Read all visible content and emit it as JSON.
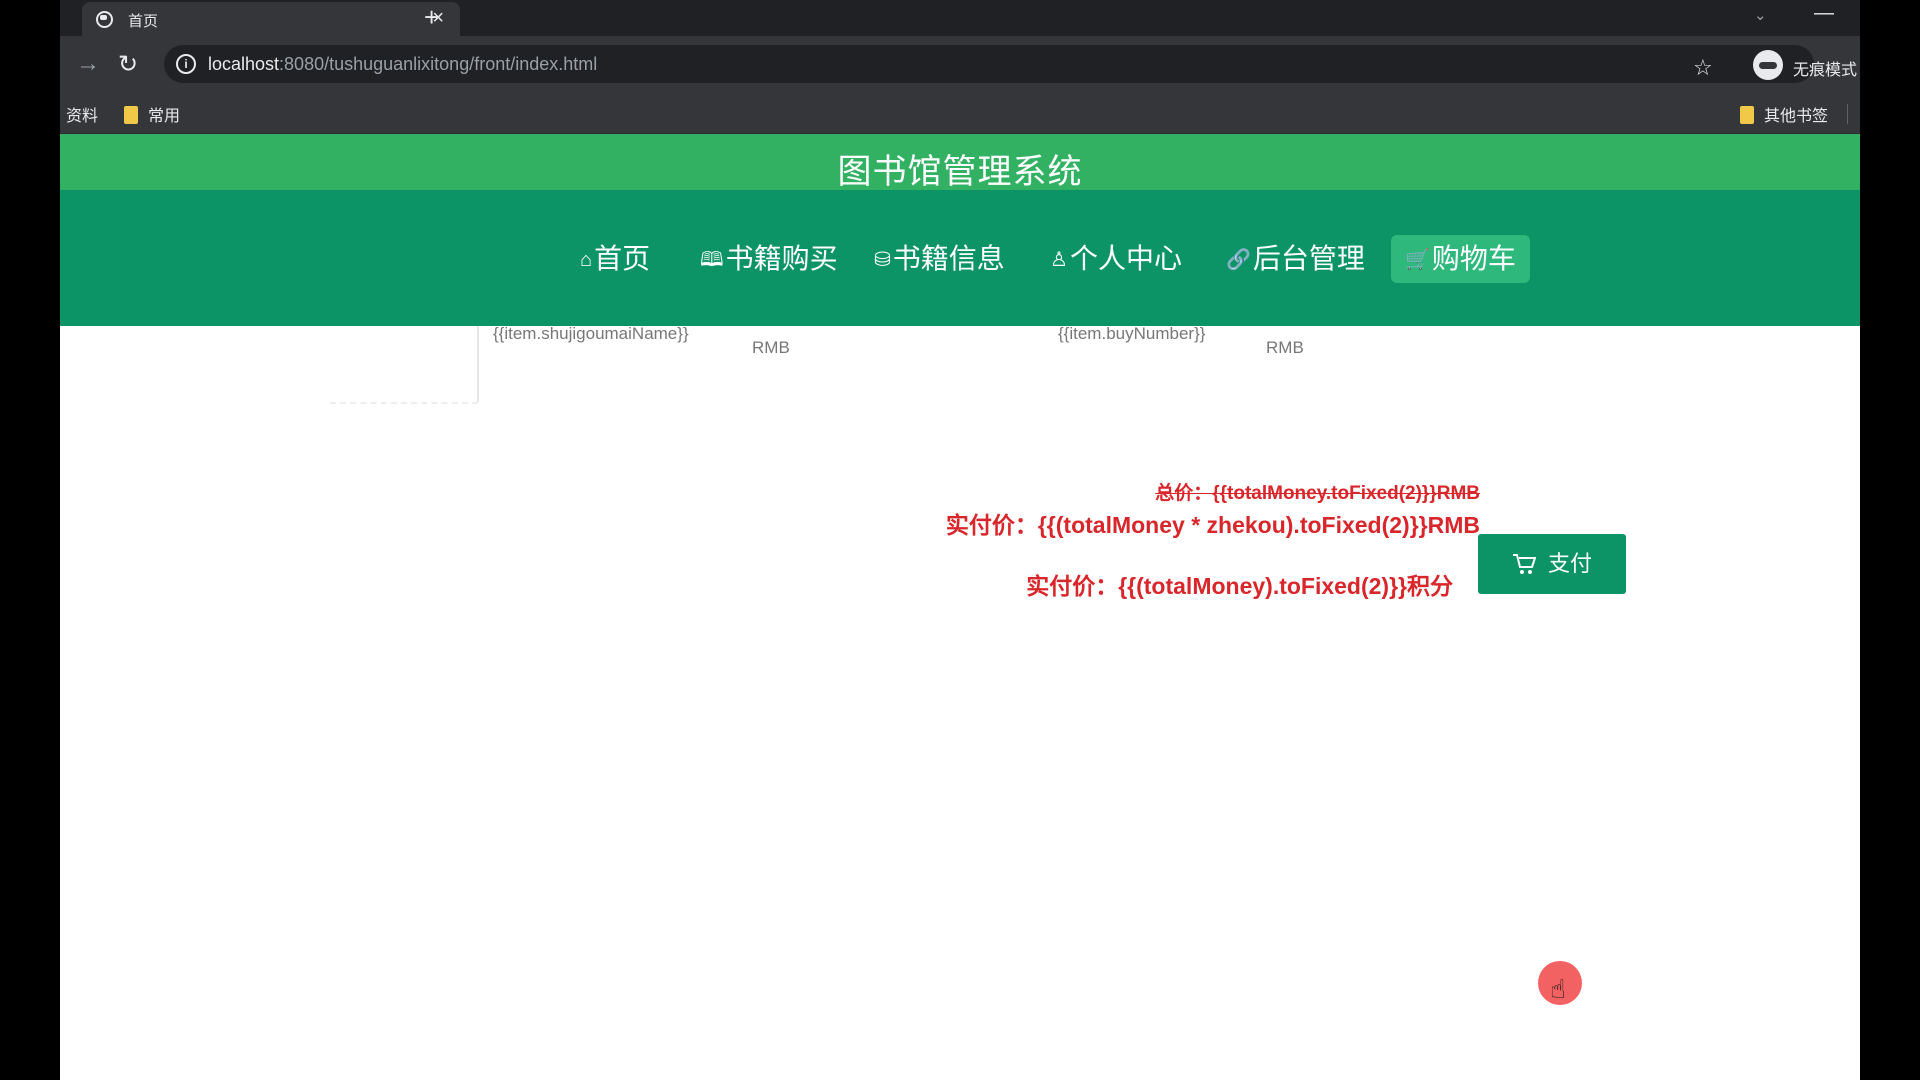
{
  "browser": {
    "tab_title": "首页",
    "tab_close": "×",
    "new_tab": "+",
    "url_host": "localhost",
    "url_rest": ":8080/tushuguanlixitong/front/index.html",
    "incognito_label": "无痕模式",
    "bookmarks": [
      "资料",
      "常用"
    ],
    "other_bookmarks": "其他书签"
  },
  "site": {
    "title": "图书馆管理系统",
    "nav": [
      {
        "label": "首页",
        "icon": "⌂",
        "icon_name": "home-icon"
      },
      {
        "label": "书籍购买",
        "icon": "🕮",
        "icon_name": "book-icon"
      },
      {
        "label": "书籍信息",
        "icon": "⛁",
        "icon_name": "database-icon"
      },
      {
        "label": "个人中心",
        "icon": "♙",
        "icon_name": "user-icon"
      },
      {
        "label": "后台管理",
        "icon": "🔗",
        "icon_name": "link-icon"
      },
      {
        "label": "购物车",
        "icon": "🛒",
        "icon_name": "cart-icon",
        "active": true
      }
    ]
  },
  "cart": {
    "row": {
      "name": "{{item.shujigoumaiName}}",
      "unit1": "RMB",
      "buy_number": "{{item.buyNumber}}",
      "unit2": "RMB"
    },
    "total_price": "总价：{{totalMoney.toFixed(2)}}RMB",
    "actual_price": "实付价：{{(totalMoney * zhekou).toFixed(2)}}RMB",
    "actual_points": "实付价：{{(totalMoney).toFixed(2)}}积分",
    "pay_label": "支付"
  },
  "colors": {
    "header_green": "#33b163",
    "nav_green": "#0c9366",
    "price_red": "#d9262b"
  }
}
